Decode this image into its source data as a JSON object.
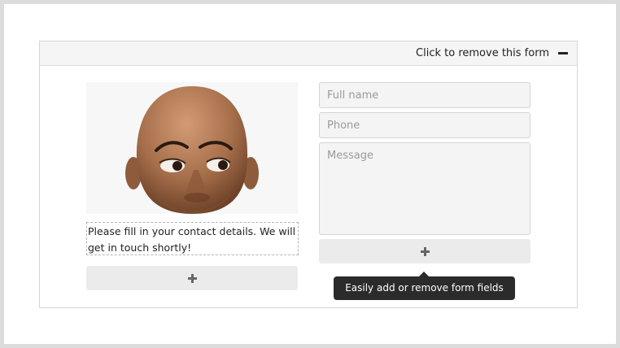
{
  "header": {
    "remove_label": "Click to remove this form",
    "remove_icon": "minus-icon"
  },
  "photo": {
    "subject": "man-photo"
  },
  "caption": {
    "text": "Please fill in your contact details. We will get in touch shortly!"
  },
  "form": {
    "fields": [
      {
        "placeholder": "Full name"
      },
      {
        "placeholder": "Phone"
      },
      {
        "placeholder": "Message"
      }
    ],
    "add_icon": "plus-icon"
  },
  "left_add": {
    "icon": "plus-icon"
  },
  "tooltip": {
    "text": "Easily add or remove form fields"
  },
  "colors": {
    "background": "#dcdcdc",
    "panel_header": "#f5f5f5",
    "field_bg": "#f4f4f4",
    "button_bg": "#ebebeb",
    "tooltip_bg": "#2b2b2b"
  }
}
